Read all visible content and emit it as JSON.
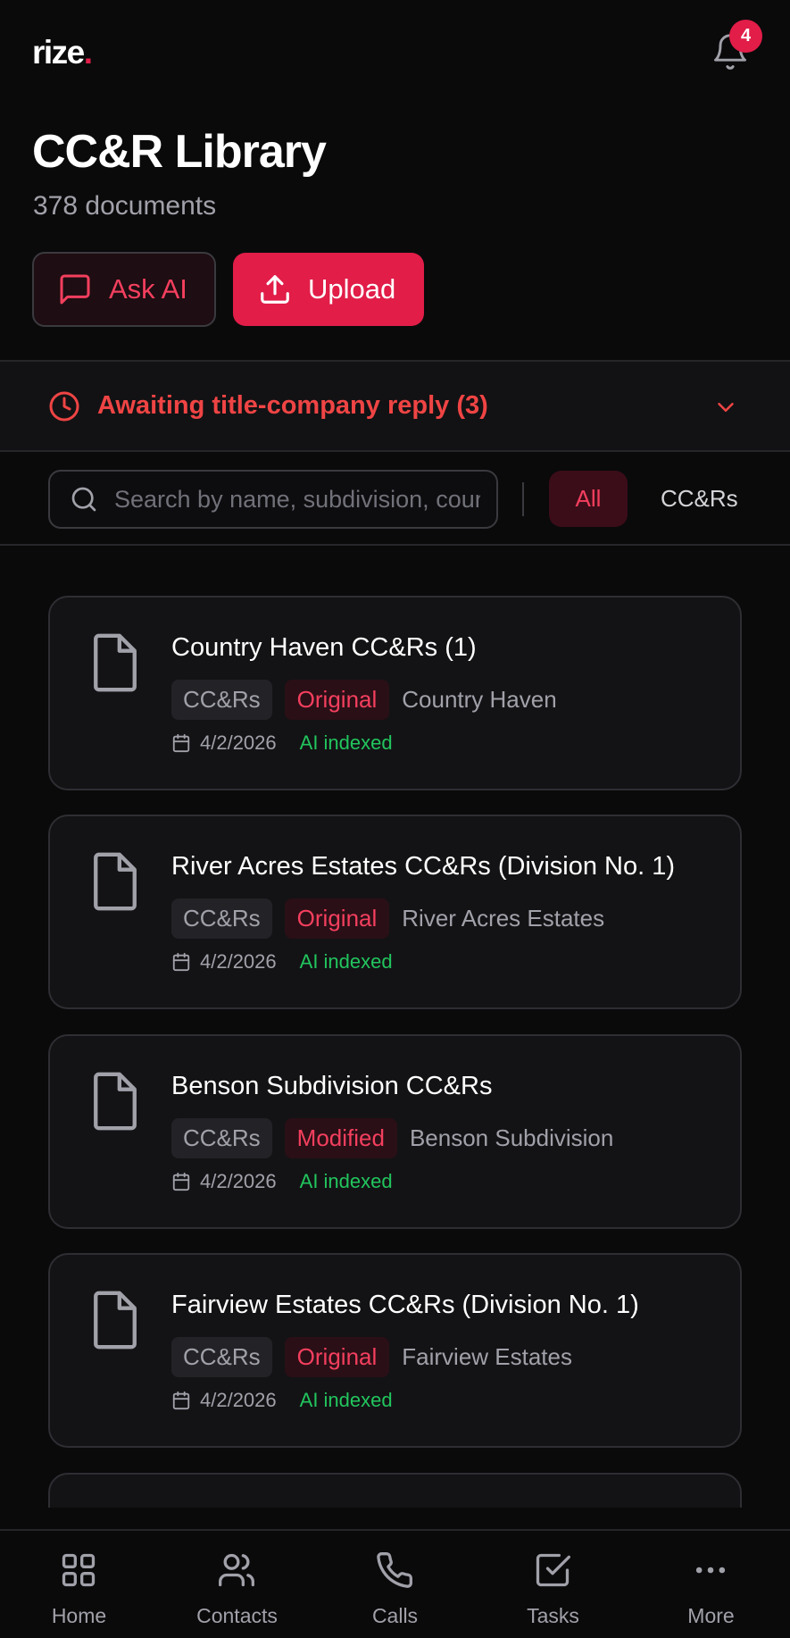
{
  "header": {
    "logo_text": "rize",
    "logo_dot": ".",
    "notification_count": "4",
    "title": "CC&R Library",
    "subtitle": "378 documents"
  },
  "actions": {
    "ask_ai_label": "Ask AI",
    "upload_label": "Upload"
  },
  "awaiting_banner": {
    "label": "Awaiting title-company reply (3)"
  },
  "filters": {
    "search_placeholder": "Search by name, subdivision, county",
    "chips": [
      "All",
      "CC&Rs"
    ],
    "active_chip": "All"
  },
  "documents": [
    {
      "title": "Country Haven CC&Rs (1)",
      "type": "CC&Rs",
      "status": "Original",
      "subdivision": "Country Haven",
      "date": "4/2/2026",
      "index_status": "AI indexed"
    },
    {
      "title": "River Acres Estates CC&Rs (Division No. 1)",
      "type": "CC&Rs",
      "status": "Original",
      "subdivision": "River Acres Estates",
      "date": "4/2/2026",
      "index_status": "AI indexed"
    },
    {
      "title": "Benson Subdivision CC&Rs",
      "type": "CC&Rs",
      "status": "Modified",
      "subdivision": "Benson Subdivision",
      "date": "4/2/2026",
      "index_status": "AI indexed"
    },
    {
      "title": "Fairview Estates CC&Rs (Division No. 1)",
      "type": "CC&Rs",
      "status": "Original",
      "subdivision": "Fairview Estates",
      "date": "4/2/2026",
      "index_status": "AI indexed"
    }
  ],
  "bottom_nav": [
    {
      "label": "Home",
      "icon": "grid-icon"
    },
    {
      "label": "Contacts",
      "icon": "users-icon"
    },
    {
      "label": "Calls",
      "icon": "phone-icon"
    },
    {
      "label": "Tasks",
      "icon": "checkbox-icon"
    },
    {
      "label": "More",
      "icon": "more-icon"
    }
  ],
  "colors": {
    "accent": "#e11d48",
    "success": "#22c55e",
    "background": "#0a0a0b",
    "card": "#131315"
  }
}
